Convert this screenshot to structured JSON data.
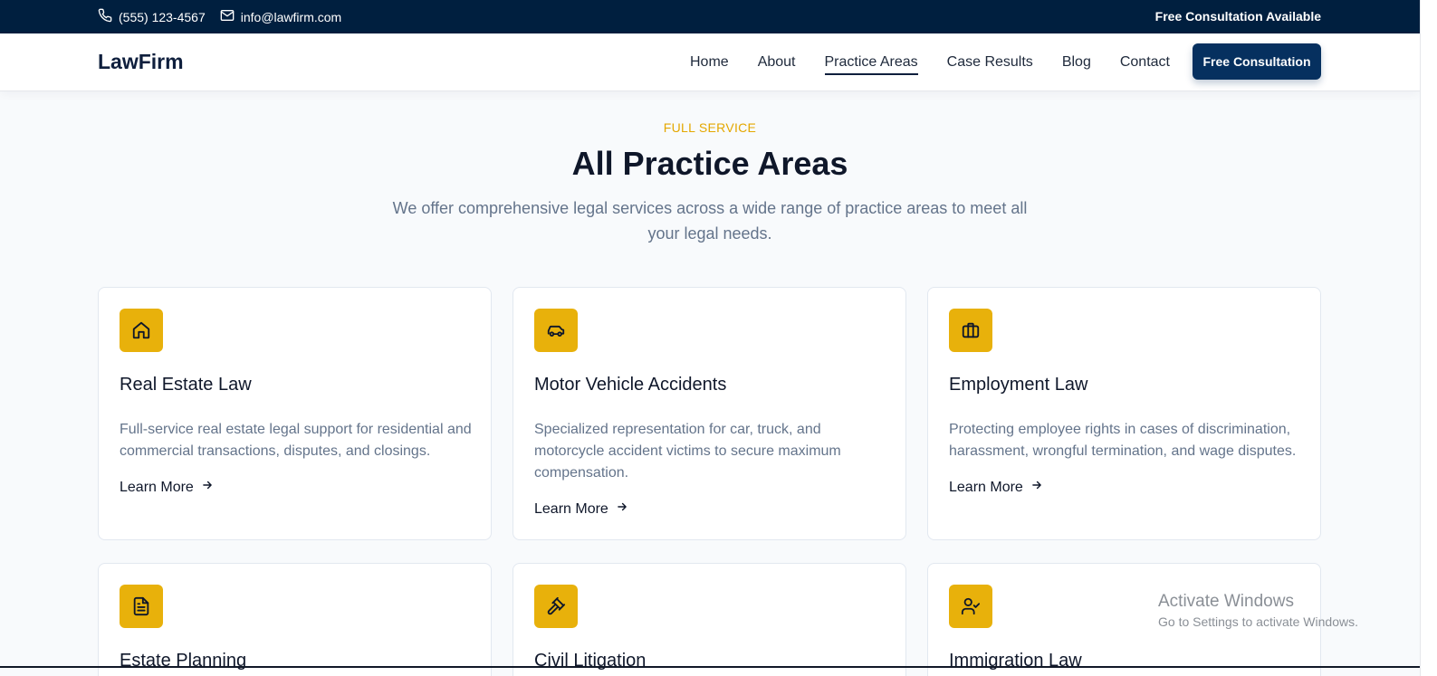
{
  "topbar": {
    "phone": "(555) 123-4567",
    "email": "info@lawfirm.com",
    "promo": "Free Consultation Available"
  },
  "navbar": {
    "logo": "LawFirm",
    "links": [
      "Home",
      "About",
      "Practice Areas",
      "Case Results",
      "Blog",
      "Contact"
    ],
    "active": "Practice Areas",
    "cta": "Free Consultation"
  },
  "hero": {
    "eyebrow": "FULL SERVICE",
    "title": "All Practice Areas",
    "subtitle": "We offer comprehensive legal services across a wide range of practice areas to meet all your legal needs."
  },
  "cards": [
    {
      "icon": "home-icon",
      "title": "Real Estate Law",
      "description": "Full-service real estate legal support for residential and commercial transactions, disputes, and closings.",
      "link": "Learn More"
    },
    {
      "icon": "car-icon",
      "title": "Motor Vehicle Accidents",
      "description": "Specialized representation for car, truck, and motorcycle accident victims to secure maximum compensation.",
      "link": "Learn More"
    },
    {
      "icon": "briefcase-icon",
      "title": "Employment Law",
      "description": "Protecting employee rights in cases of discrimination, harassment, wrongful termination, and wage disputes.",
      "link": "Learn More"
    },
    {
      "icon": "document-icon",
      "title": "Estate Planning"
    },
    {
      "icon": "gavel-icon",
      "title": "Civil Litigation"
    },
    {
      "icon": "user-check-icon",
      "title": "Immigration Law"
    }
  ],
  "watermark": {
    "line1": "Activate Windows",
    "line2": "Go to Settings to activate Windows."
  },
  "colors": {
    "topbar_bg": "#001f3f",
    "accent": "#e8b10b",
    "cta_bg": "#06305f"
  }
}
